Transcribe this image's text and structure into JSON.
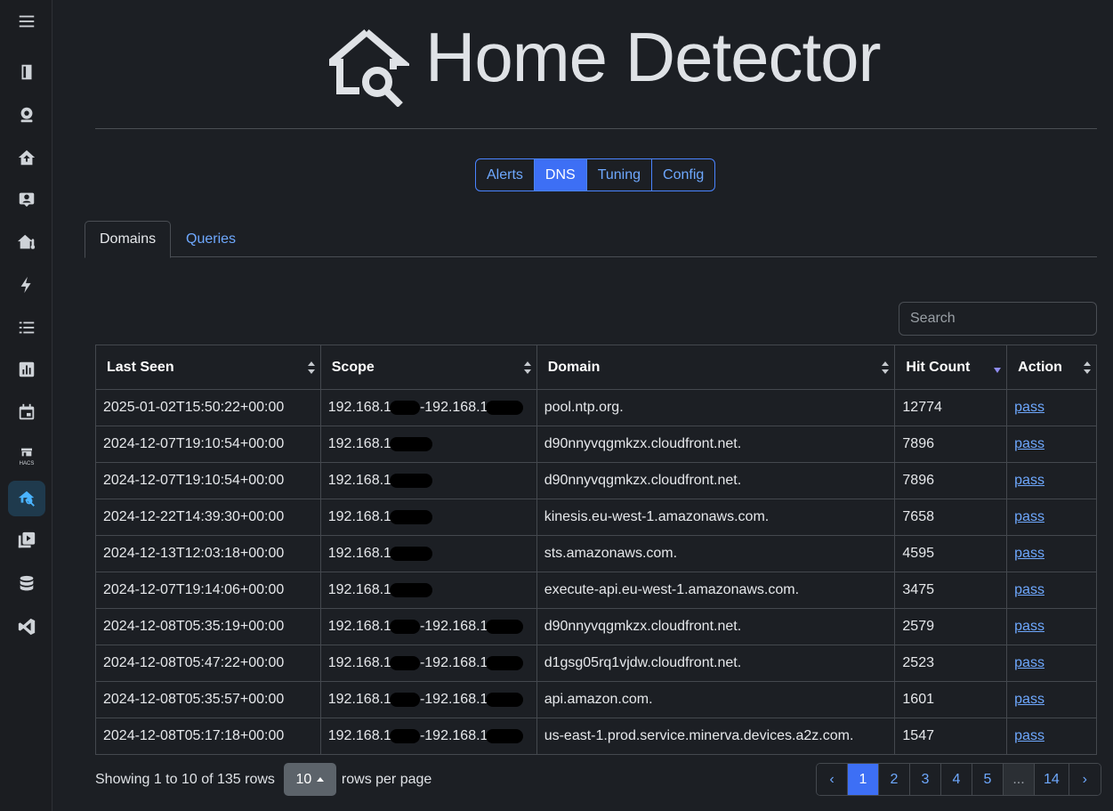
{
  "header": {
    "title": "Home Detector"
  },
  "nav": {
    "buttons": [
      "Alerts",
      "DNS",
      "Tuning",
      "Config"
    ],
    "active": "DNS"
  },
  "tabs": {
    "items": [
      "Domains",
      "Queries"
    ],
    "active": "Domains"
  },
  "search": {
    "placeholder": "Search"
  },
  "table": {
    "columns": [
      "Last Seen",
      "Scope",
      "Domain",
      "Hit Count",
      "Action"
    ],
    "rows": [
      {
        "last_seen": "2025-01-02T15:50:22+00:00",
        "scope": "192.168.1",
        "scope2": "-192.168.1",
        "domain": "pool.ntp.org.",
        "hits": "12774",
        "action": "pass"
      },
      {
        "last_seen": "2024-12-07T19:10:54+00:00",
        "scope": "192.168.1",
        "scope2": "",
        "domain": "d90nnyvqgmkzx.cloudfront.net.",
        "hits": "7896",
        "action": "pass"
      },
      {
        "last_seen": "2024-12-07T19:10:54+00:00",
        "scope": "192.168.1",
        "scope2": "",
        "domain": "d90nnyvqgmkzx.cloudfront.net.",
        "hits": "7896",
        "action": "pass"
      },
      {
        "last_seen": "2024-12-22T14:39:30+00:00",
        "scope": "192.168.1",
        "scope2": "",
        "domain": "kinesis.eu-west-1.amazonaws.com.",
        "hits": "7658",
        "action": "pass"
      },
      {
        "last_seen": "2024-12-13T12:03:18+00:00",
        "scope": "192.168.1",
        "scope2": "",
        "domain": "sts.amazonaws.com.",
        "hits": "4595",
        "action": "pass"
      },
      {
        "last_seen": "2024-12-07T19:14:06+00:00",
        "scope": "192.168.1",
        "scope2": "",
        "domain": "execute-api.eu-west-1.amazonaws.com.",
        "hits": "3475",
        "action": "pass"
      },
      {
        "last_seen": "2024-12-08T05:35:19+00:00",
        "scope": "192.168.1",
        "scope2": "-192.168.1",
        "domain": "d90nnyvqgmkzx.cloudfront.net.",
        "hits": "2579",
        "action": "pass"
      },
      {
        "last_seen": "2024-12-08T05:47:22+00:00",
        "scope": "192.168.1",
        "scope2": "-192.168.1",
        "domain": "d1gsg05rq1vjdw.cloudfront.net.",
        "hits": "2523",
        "action": "pass"
      },
      {
        "last_seen": "2024-12-08T05:35:57+00:00",
        "scope": "192.168.1",
        "scope2": "-192.168.1",
        "domain": "api.amazon.com.",
        "hits": "1601",
        "action": "pass"
      },
      {
        "last_seen": "2024-12-08T05:17:18+00:00",
        "scope": "192.168.1",
        "scope2": "-192.168.1",
        "domain": "us-east-1.prod.service.minerva.devices.a2z.com.",
        "hits": "1547",
        "action": "pass"
      }
    ]
  },
  "footer": {
    "showing": "Showing 1 to 10 of 135 rows",
    "rows_per_page_value": "10",
    "rows_per_page_label": "rows per page",
    "pages": [
      "‹",
      "1",
      "2",
      "3",
      "4",
      "5",
      "...",
      "14",
      "›"
    ],
    "active_page": "1"
  },
  "colors": {
    "accent": "#3d6ff5",
    "link": "#6ea8fe",
    "background": "#1c1f24",
    "sidebar_active": "#4ab3ff"
  },
  "sidebar": {
    "icons": [
      "menu-icon",
      "dashboard-icon",
      "webcam-icon",
      "home-upload-icon",
      "account-box-icon",
      "home-thermometer-icon",
      "energy-icon",
      "list-icon",
      "chart-icon",
      "calendar-icon",
      "hacs-icon",
      "home-search-icon",
      "media-icon",
      "database-icon",
      "vscode-icon"
    ],
    "hacs_label": "HACS"
  }
}
